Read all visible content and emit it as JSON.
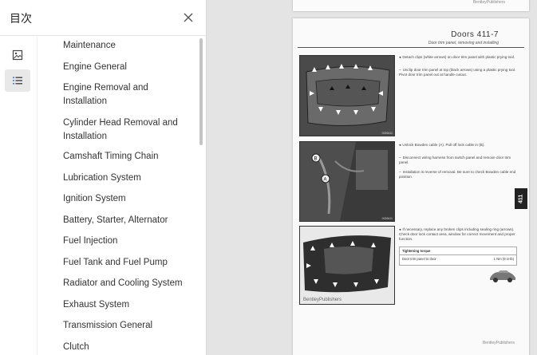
{
  "sidebar": {
    "title": "目次",
    "close_label": "close",
    "toc": [
      "Maintenance",
      "Engine General",
      "Engine Removal and Installation",
      "Cylinder Head Removal and Installation",
      "Camshaft Timing Chain",
      "Lubrication System",
      "Ignition System",
      "Battery, Starter, Alternator",
      "Fuel Injection",
      "Fuel Tank and Fuel Pump",
      "Radiator and Cooling System",
      "Exhaust System",
      "Transmission General",
      "Clutch"
    ]
  },
  "page": {
    "title": "Doors 411-7",
    "subtitle": "Door trim panel, removing and installing",
    "tab": "411",
    "brand": "BentleyPublishers",
    "brand_footer": "BentleyPublishers",
    "notes": [
      "Detach clips (white arrows) on door trim panel with plastic prying tool.",
      "Unclip door trim panel at top (black arrows) using a plastic prying tool. Pivot door trim panel out at handle cutout.",
      "Unlock Bowden cable (A). Pull off lock cable in (B).",
      "Disconnect wiring harness from switch panel and remove door trim panel.",
      "Installation is reverse of removal. Be sure to check Bowden cable end position.",
      "If necessary, replace any broken clips including sealing ring (arrows). Check door lock contact area, window for correct movement and proper function."
    ],
    "torque_title": "Tightening torque",
    "torque_row_label": "Door trim panel to door",
    "torque_row_value": "1 Nm (9 in-lb)"
  },
  "icons": {
    "close": "close-icon",
    "thumbnails": "image-thumbnail-icon",
    "toc": "list-toc-icon"
  }
}
